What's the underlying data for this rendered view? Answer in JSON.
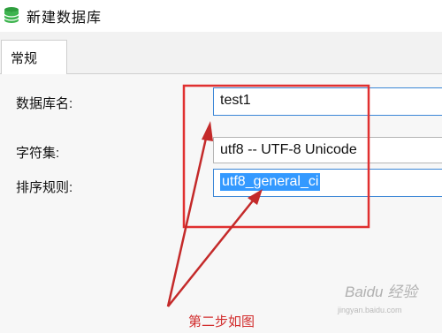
{
  "window": {
    "title": "新建数据库"
  },
  "tabs": [
    {
      "label": "常规"
    }
  ],
  "form": {
    "db_name_label": "数据库名:",
    "db_name_value": "test1",
    "charset_label": "字符集:",
    "charset_value": "utf8 -- UTF-8 Unicode",
    "collation_label": "排序规则:",
    "collation_value": "utf8_general_ci"
  },
  "annotation": {
    "caption": "第二步如图",
    "color": "#d22d2d"
  },
  "watermark": {
    "text": "Baidu 经验",
    "sub": "jingyan.baidu.com"
  },
  "colors": {
    "accent": "#3399ff",
    "annotation_red": "#d22d2d"
  }
}
